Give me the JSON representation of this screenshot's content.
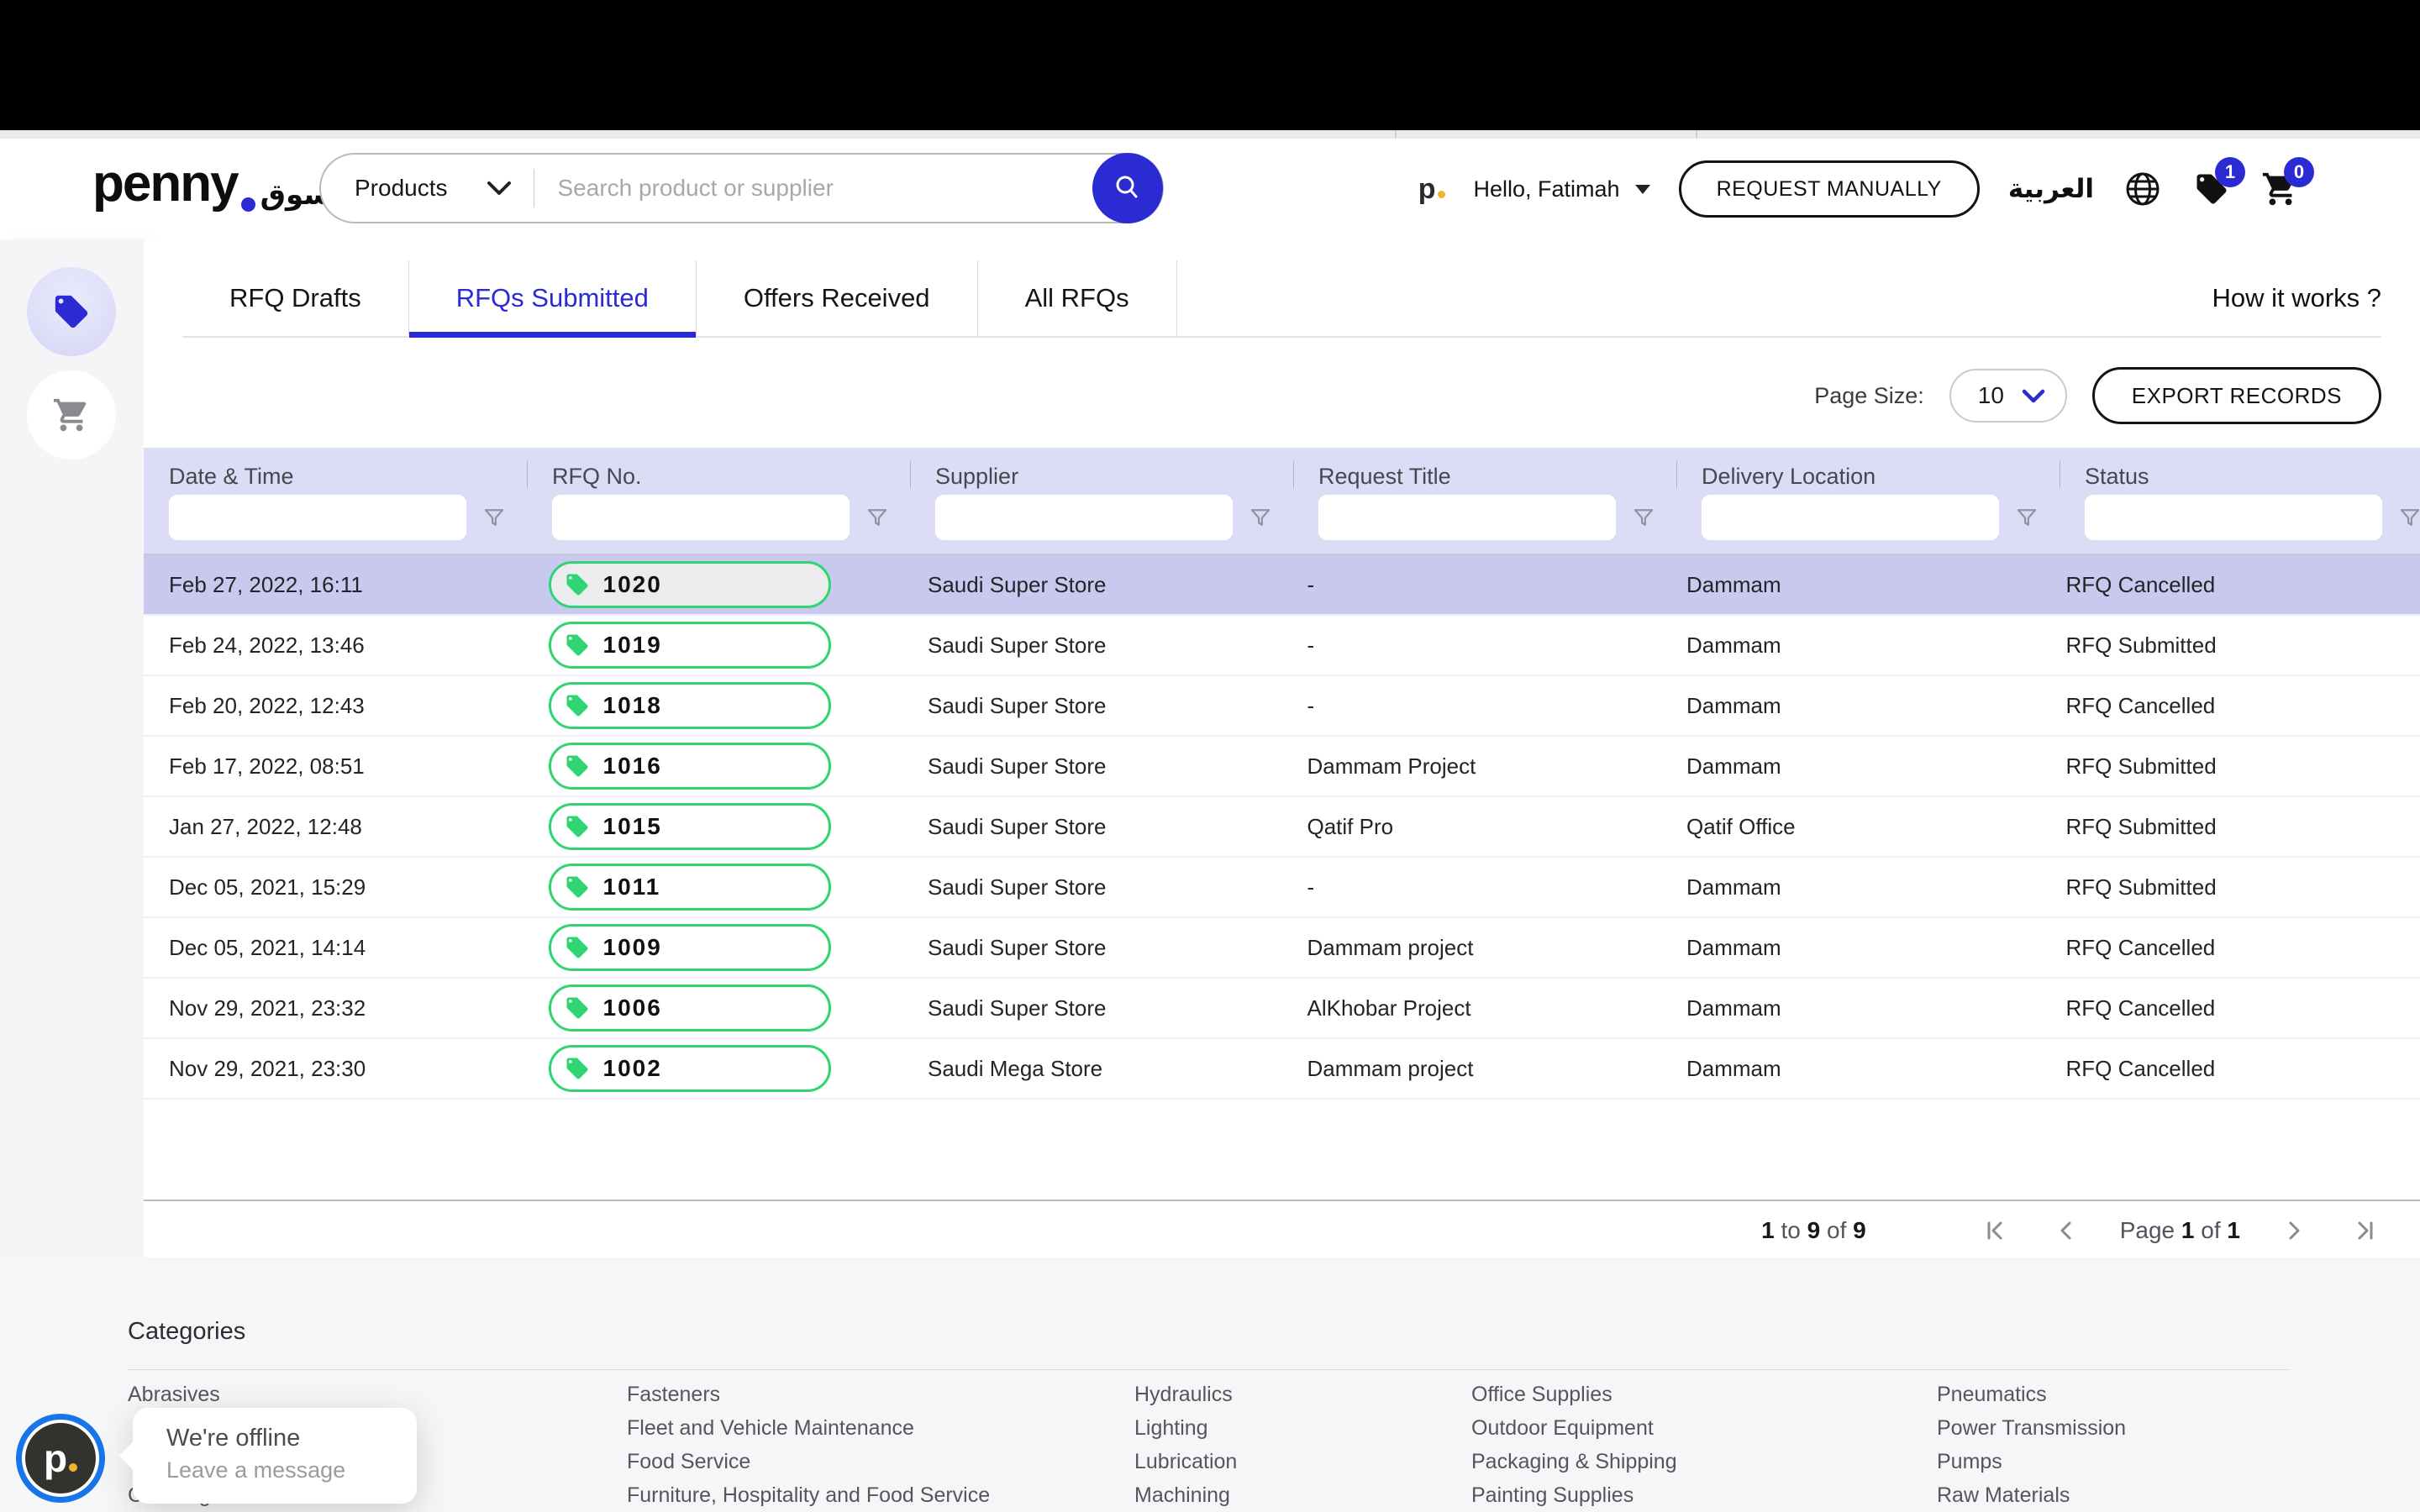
{
  "brand": {
    "logo_text": "penny",
    "logo_suffix_arabic": "سوق",
    "mini_logo": "p"
  },
  "header": {
    "category_select": "Products",
    "search_placeholder": "Search product or supplier",
    "greeting": "Hello, Fatimah",
    "request_manually_label": "REQUEST MANUALLY",
    "language_label": "العربية",
    "rfq_badge_count": "1",
    "cart_badge_count": "0"
  },
  "tabs": [
    {
      "label": "RFQ Drafts",
      "active": false
    },
    {
      "label": "RFQs Submitted",
      "active": true
    },
    {
      "label": "Offers Received",
      "active": false
    },
    {
      "label": "All RFQs",
      "active": false
    }
  ],
  "how_it_works_label": "How it works ?",
  "toolbar": {
    "page_size_label": "Page Size:",
    "page_size_value": "10",
    "export_label": "EXPORT RECORDS"
  },
  "table": {
    "columns": [
      "Date & Time",
      "RFQ No.",
      "Supplier",
      "Request Title",
      "Delivery Location",
      "Status"
    ],
    "rows": [
      {
        "date": "Feb 27, 2022, 16:11",
        "rfq": "1020",
        "supplier": "Saudi Super Store",
        "title": "-",
        "location": "Dammam",
        "status": "RFQ Cancelled",
        "highlighted": true
      },
      {
        "date": "Feb 24, 2022, 13:46",
        "rfq": "1019",
        "supplier": "Saudi Super Store",
        "title": "-",
        "location": "Dammam",
        "status": "RFQ Submitted",
        "highlighted": false
      },
      {
        "date": "Feb 20, 2022, 12:43",
        "rfq": "1018",
        "supplier": "Saudi Super Store",
        "title": "-",
        "location": "Dammam",
        "status": "RFQ Cancelled",
        "highlighted": false
      },
      {
        "date": "Feb 17, 2022, 08:51",
        "rfq": "1016",
        "supplier": "Saudi Super Store",
        "title": "Dammam Project",
        "location": "Dammam",
        "status": "RFQ Submitted",
        "highlighted": false
      },
      {
        "date": "Jan 27, 2022, 12:48",
        "rfq": "1015",
        "supplier": "Saudi Super Store",
        "title": "Qatif Pro",
        "location": "Qatif Office",
        "status": "RFQ Submitted",
        "highlighted": false
      },
      {
        "date": "Dec 05, 2021, 15:29",
        "rfq": "1011",
        "supplier": "Saudi Super Store",
        "title": "-",
        "location": "Dammam",
        "status": "RFQ Submitted",
        "highlighted": false
      },
      {
        "date": "Dec 05, 2021, 14:14",
        "rfq": "1009",
        "supplier": "Saudi Super Store",
        "title": "Dammam project",
        "location": "Dammam",
        "status": "RFQ Cancelled",
        "highlighted": false
      },
      {
        "date": "Nov 29, 2021, 23:32",
        "rfq": "1006",
        "supplier": "Saudi Super Store",
        "title": "AlKhobar Project",
        "location": "Dammam",
        "status": "RFQ Cancelled",
        "highlighted": false
      },
      {
        "date": "Nov 29, 2021, 23:30",
        "rfq": "1002",
        "supplier": "Saudi Mega Store",
        "title": "Dammam project",
        "location": "Dammam",
        "status": "RFQ Cancelled",
        "highlighted": false
      }
    ]
  },
  "pagination": {
    "summary": {
      "from": "1",
      "to_word": "to",
      "to": "9",
      "of_word": "of",
      "total": "9"
    },
    "page": {
      "label": "Page",
      "current": "1",
      "of_word": "of",
      "total": "1"
    }
  },
  "footer": {
    "heading": "Categories",
    "columns": [
      [
        "Abrasives",
        "Cleaning and Janitorial"
      ],
      [
        "Fasteners",
        "Fleet and Vehicle Maintenance",
        "Food Service",
        "Furniture, Hospitality and Food Service"
      ],
      [
        "Hydraulics",
        "Lighting",
        "Lubrication",
        "Machining"
      ],
      [
        "Office Supplies",
        "Outdoor Equipment",
        "Packaging & Shipping",
        "Painting Supplies"
      ],
      [
        "Pneumatics",
        "Power Transmission",
        "Pumps",
        "Raw Materials"
      ]
    ]
  },
  "chat": {
    "status_text": "We're offline",
    "action_text": "Leave a message",
    "avatar_letter": "p"
  },
  "colors": {
    "accent_blue": "#2b2bd4",
    "chip_green": "#2fd573",
    "table_header": "#dcdcf6",
    "row_highlight": "#c9c9ef",
    "chat_ring_blue": "#1974e8",
    "brand_dot_yellow": "#f0b429"
  }
}
